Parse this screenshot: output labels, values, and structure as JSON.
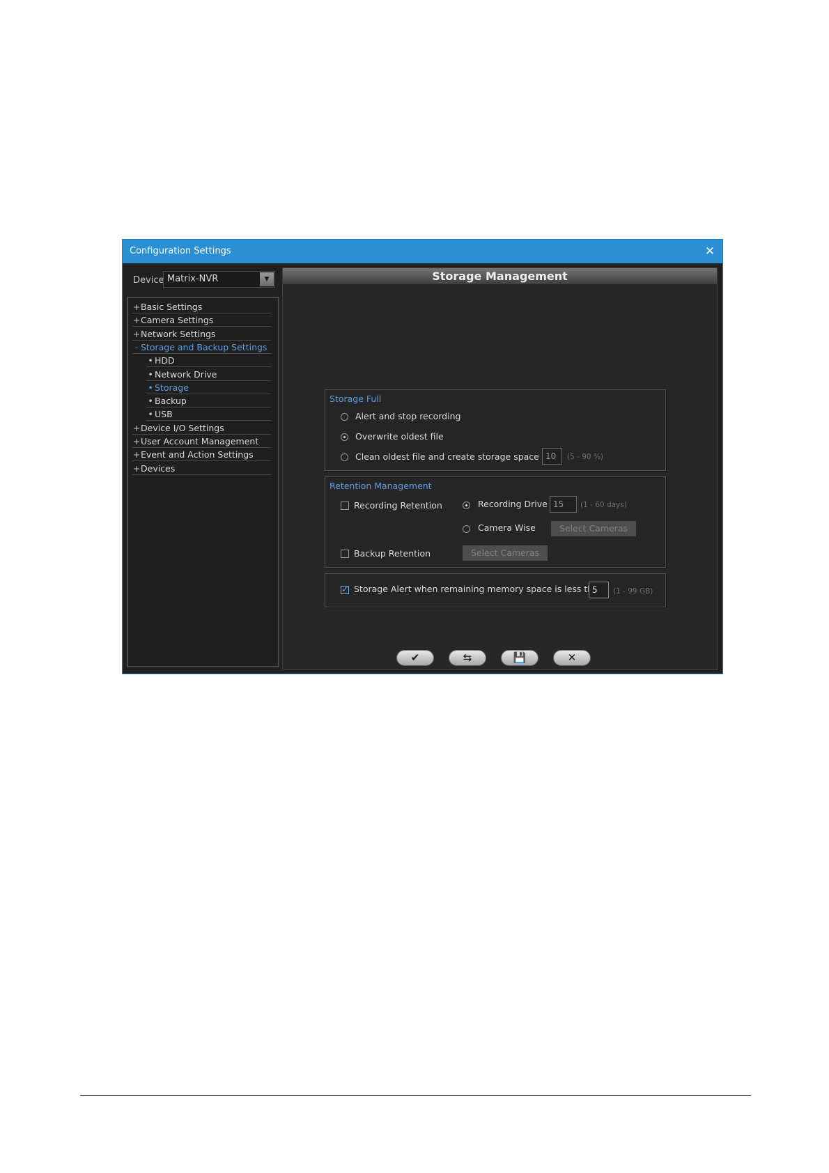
{
  "window": {
    "title": "Configuration Settings",
    "close_glyph": "✕"
  },
  "device": {
    "label": "Device",
    "value": "Matrix-NVR",
    "arrow": "▼"
  },
  "tree": [
    {
      "marker": "+",
      "label": "Basic Settings"
    },
    {
      "marker": "+",
      "label": "Camera Settings"
    },
    {
      "marker": "+",
      "label": "Network Settings"
    },
    {
      "marker": "-",
      "label": "Storage and Backup Settings",
      "active": true
    },
    {
      "marker": "•",
      "label": "HDD",
      "child": true
    },
    {
      "marker": "•",
      "label": "Network Drive",
      "child": true
    },
    {
      "marker": "•",
      "label": "Storage",
      "child": true,
      "active": true
    },
    {
      "marker": "•",
      "label": "Backup",
      "child": true
    },
    {
      "marker": "•",
      "label": "USB",
      "child": true
    },
    {
      "marker": "+",
      "label": "Device I/O Settings"
    },
    {
      "marker": "+",
      "label": "User Account Management"
    },
    {
      "marker": "+",
      "label": "Event and Action Settings"
    },
    {
      "marker": "+",
      "label": "Devices"
    }
  ],
  "main": {
    "title": "Storage Management",
    "storage_full": {
      "title": "Storage Full",
      "option1": "Alert and stop recording",
      "option2": "Overwrite oldest file",
      "option3": "Clean oldest file and create storage space of",
      "space_value": "10",
      "space_hint": "(5 - 90 %)",
      "selected": 2
    },
    "retention": {
      "title": "Retention Management",
      "recording_retention": "Recording Retention",
      "recording_drive": "Recording Drive",
      "drive_days": "15",
      "drive_hint": "(1 - 60 days)",
      "camera_wise": "Camera Wise",
      "select_cameras": "Select Cameras",
      "backup_retention": "Backup Retention",
      "backup_select_cameras": "Select Cameras"
    },
    "alert": {
      "label": "Storage Alert when remaining memory space is less than",
      "value": "5",
      "hint": "(1 - 99 GB)",
      "checked": true
    },
    "actions": {
      "apply_icon": "✔",
      "refresh_icon": "⇆",
      "save_icon": "💾",
      "close_icon": "✕"
    }
  }
}
